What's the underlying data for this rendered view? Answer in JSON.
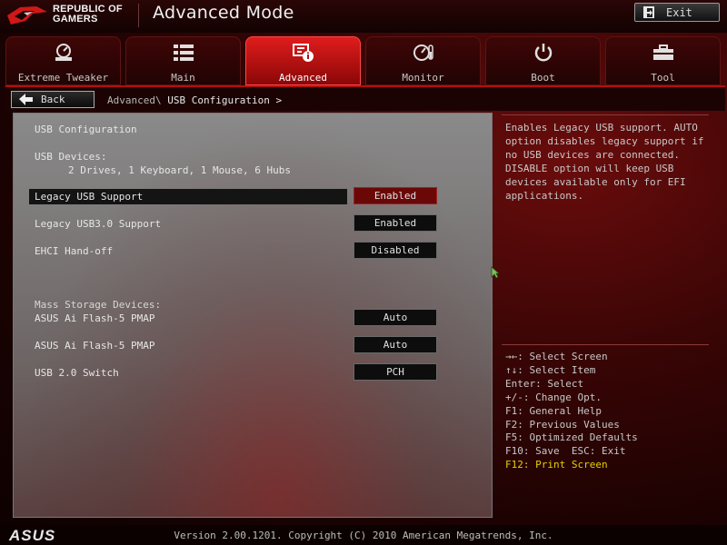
{
  "header": {
    "brand_line1": "REPUBLIC OF",
    "brand_line2": "GAMERS",
    "title": "Advanced Mode",
    "exit_label": "Exit"
  },
  "tabs": [
    {
      "label": "Extreme Tweaker",
      "icon": "dial-icon"
    },
    {
      "label": "Main",
      "icon": "list-icon"
    },
    {
      "label": "Advanced",
      "icon": "chip-info-icon",
      "active": true
    },
    {
      "label": "Monitor",
      "icon": "gauge-icon"
    },
    {
      "label": "Boot",
      "icon": "power-icon"
    },
    {
      "label": "Tool",
      "icon": "toolbox-icon"
    }
  ],
  "nav": {
    "back_label": "Back",
    "crumb_parent": "Advanced\\",
    "crumb_current": "USB Configuration >"
  },
  "main": {
    "section_title": "USB Configuration",
    "devices_label": "USB Devices:",
    "devices_value": "2 Drives, 1 Keyboard, 1 Mouse, 6 Hubs",
    "settings": [
      {
        "label": "Legacy USB Support",
        "value": "Enabled",
        "selected": true
      },
      {
        "label": "Legacy USB3.0 Support",
        "value": "Enabled"
      },
      {
        "label": "EHCI Hand-off",
        "value": "Disabled"
      }
    ],
    "mass_storage_label": "Mass Storage Devices:",
    "storage": [
      {
        "label": "ASUS Ai Flash-5 PMAP",
        "value": "Auto"
      },
      {
        "label": "ASUS Ai Flash-5 PMAP",
        "value": "Auto"
      },
      {
        "label": "USB 2.0 Switch",
        "value": "PCH"
      }
    ]
  },
  "help": {
    "description": "Enables Legacy USB support. AUTO option disables legacy support if no USB devices are connected. DISABLE option will keep USB devices available only for EFI applications.",
    "keys": [
      "→←: Select Screen",
      "↑↓: Select Item",
      "Enter: Select",
      "+/-: Change Opt.",
      "F1: General Help",
      "F2: Previous Values",
      "F5: Optimized Defaults",
      "F10: Save  ESC: Exit",
      "F12: Print Screen"
    ]
  },
  "footer": {
    "brand": "ASUS",
    "version": "Version 2.00.1201. Copyright (C) 2010 American Megatrends, Inc."
  },
  "colors": {
    "accent_red": "#e01c1c",
    "highlight_yellow": "#e8d000",
    "selected_value_bg": "#6a0808"
  }
}
